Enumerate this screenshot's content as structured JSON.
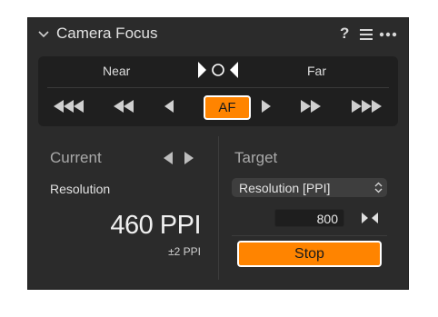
{
  "header": {
    "title": "Camera Focus",
    "help_label": "?",
    "collapse_icon": "chevron-down-icon",
    "menu_icon": "hamburger-menu-icon",
    "more_icon": "ellipsis-icon"
  },
  "focus": {
    "near_label": "Near",
    "far_label": "Far",
    "af_label": "AF",
    "steps": [
      {
        "name": "near-step-large",
        "icon": "triple-left-arrow-icon"
      },
      {
        "name": "near-step-medium",
        "icon": "double-left-arrow-icon"
      },
      {
        "name": "near-step-small",
        "icon": "left-arrow-icon"
      },
      {
        "name": "far-step-small",
        "icon": "right-arrow-icon"
      },
      {
        "name": "far-step-medium",
        "icon": "double-right-arrow-icon"
      },
      {
        "name": "far-step-large",
        "icon": "triple-right-arrow-icon"
      }
    ]
  },
  "current": {
    "label": "Current",
    "metric_label": "Resolution",
    "value": "460 PPI",
    "tolerance": "±2 PPI"
  },
  "target": {
    "label": "Target",
    "select_value": "Resolution [PPI]",
    "input_value": "800",
    "button_label": "Stop"
  },
  "colors": {
    "panel_bg": "#2b2b2b",
    "focus_box_bg": "#1f1f1f",
    "accent": "#ff8400",
    "muted_text": "#a9a9a9",
    "text": "#e2e2e2"
  }
}
